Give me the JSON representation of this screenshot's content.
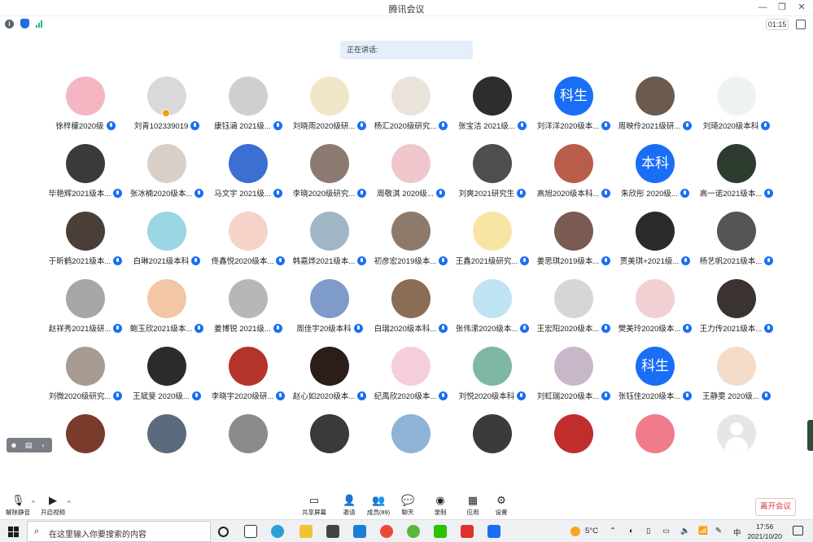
{
  "window": {
    "title": "腾讯会议"
  },
  "timer": "01:15",
  "speaking_label": "正在讲话:",
  "participants": [
    {
      "name": "徐梓檬2020级"
    },
    {
      "name": "刘青102339019"
    },
    {
      "name": "康钰涵 2021级..."
    },
    {
      "name": "刘晓雨2020级研..."
    },
    {
      "name": "杨汇2020级研究..."
    },
    {
      "name": "张宝洁 2021级..."
    },
    {
      "name": "刘洋洋2020级本...",
      "avatar_text": "科生"
    },
    {
      "name": "周映伶2021级研..."
    },
    {
      "name": "刘琦2020级本科"
    },
    {
      "name": "毕艳辉2021级本..."
    },
    {
      "name": "张冰楠2020级本..."
    },
    {
      "name": "马文宇 2021级..."
    },
    {
      "name": "李晓2020级研究..."
    },
    {
      "name": "周敬淇 2020级..."
    },
    {
      "name": "刘爽2021研究生"
    },
    {
      "name": "高旭2020级本科..."
    },
    {
      "name": "朱欣彤 2020级...",
      "avatar_text": "本科"
    },
    {
      "name": "高一诺2021级本..."
    },
    {
      "name": "于昕鹤2021级本..."
    },
    {
      "name": "白琳2021级本科"
    },
    {
      "name": "佟鑫悦2020级本..."
    },
    {
      "name": "韩嘉烨2021级本..."
    },
    {
      "name": "初彦宏2019级本..."
    },
    {
      "name": "王鑫2021级研究..."
    },
    {
      "name": "姜思琪2019级本..."
    },
    {
      "name": "贾美琪+2021级..."
    },
    {
      "name": "杨艺帆2021级本..."
    },
    {
      "name": "赵祥秀2021级研..."
    },
    {
      "name": "鲍玉欣2021级本..."
    },
    {
      "name": "姜博锐 2021级..."
    },
    {
      "name": "周佳宇20级本科"
    },
    {
      "name": "白瑞2020级本科..."
    },
    {
      "name": "张伟潆2020级本..."
    },
    {
      "name": "王宏阳2020级本..."
    },
    {
      "name": "樊美玲2020级本..."
    },
    {
      "name": "王力传2021级本..."
    },
    {
      "name": "刘微2020级研究..."
    },
    {
      "name": "王斌斐 2020级..."
    },
    {
      "name": "李晓宇2020级研..."
    },
    {
      "name": "赵心如2020级本..."
    },
    {
      "name": "纪禹欣2020级本..."
    },
    {
      "name": "刘悦2020级本科"
    },
    {
      "name": "刘虹瑞2020级本..."
    },
    {
      "name": "张钰佳2020级本...",
      "avatar_text": "科生"
    },
    {
      "name": "王静雯 2020级..."
    },
    {
      "name": ""
    },
    {
      "name": ""
    },
    {
      "name": ""
    },
    {
      "name": ""
    },
    {
      "name": ""
    },
    {
      "name": ""
    },
    {
      "name": ""
    },
    {
      "name": ""
    },
    {
      "name": ""
    }
  ],
  "toolbar": {
    "unmute": "解除静音",
    "start_video": "开启视频",
    "share_screen": "共享屏幕",
    "invite": "邀请",
    "members": "成员(89)",
    "chat": "聊天",
    "record": "录制",
    "apps": "应用",
    "settings": "设置",
    "leave": "离开会议"
  },
  "taskbar": {
    "search_placeholder": "在这里输入你要搜索的内容",
    "weather": "5°C",
    "ime": "中",
    "time": "17:56",
    "date": "2021/10/20"
  },
  "colors": {
    "accent": "#1a6ef5",
    "leave": "#d9333f",
    "speaker_bg": "#e5eefb"
  }
}
